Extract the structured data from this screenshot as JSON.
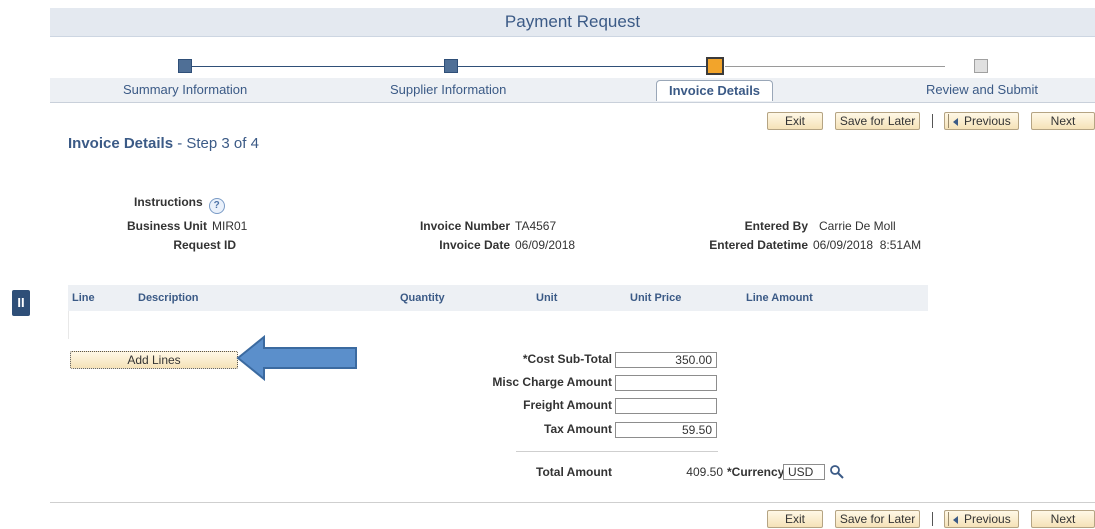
{
  "header": {
    "title": "Payment Request"
  },
  "train": {
    "steps": [
      {
        "label": "Summary Information",
        "state": "done"
      },
      {
        "label": "Supplier Information",
        "state": "done"
      },
      {
        "label": "Invoice Details",
        "state": "current"
      },
      {
        "label": "Review and Submit",
        "state": "todo"
      }
    ]
  },
  "toolbar": {
    "exit": "Exit",
    "save_for_later": "Save for Later",
    "previous": "Previous",
    "next": "Next"
  },
  "page": {
    "heading_bold": "Invoice Details",
    "heading_rest": " - Step 3 of 4"
  },
  "info": {
    "instructions_label": "Instructions",
    "business_unit_label": "Business Unit",
    "business_unit_value": "MIR01",
    "request_id_label": "Request ID",
    "request_id_value": "",
    "invoice_number_label": "Invoice Number",
    "invoice_number_value": "TA4567",
    "invoice_date_label": "Invoice Date",
    "invoice_date_value": "06/09/2018",
    "entered_by_label": "Entered By",
    "entered_by_value": "Carrie De Moll",
    "entered_datetime_label": "Entered Datetime",
    "entered_datetime_value": "06/09/2018  8:51AM"
  },
  "grid": {
    "columns": [
      "Line",
      "Description",
      "Quantity",
      "Unit",
      "Unit Price",
      "Line Amount"
    ]
  },
  "add_lines": {
    "label": "Add Lines"
  },
  "totals": {
    "cost_subtotal_label": "*Cost Sub-Total",
    "cost_subtotal_value": "350.00",
    "misc_label": "Misc Charge Amount",
    "misc_value": "",
    "freight_label": "Freight Amount",
    "freight_value": "",
    "tax_label": "Tax Amount",
    "tax_value": "59.50",
    "total_label": "Total Amount",
    "total_value": "409.50",
    "currency_label": "*Currency",
    "currency_value": "USD"
  },
  "colors": {
    "accent": "#3b5a86",
    "current_step": "#f2a42b",
    "arrow": "#5b8fcb"
  },
  "side_handle": {
    "label": "II"
  }
}
